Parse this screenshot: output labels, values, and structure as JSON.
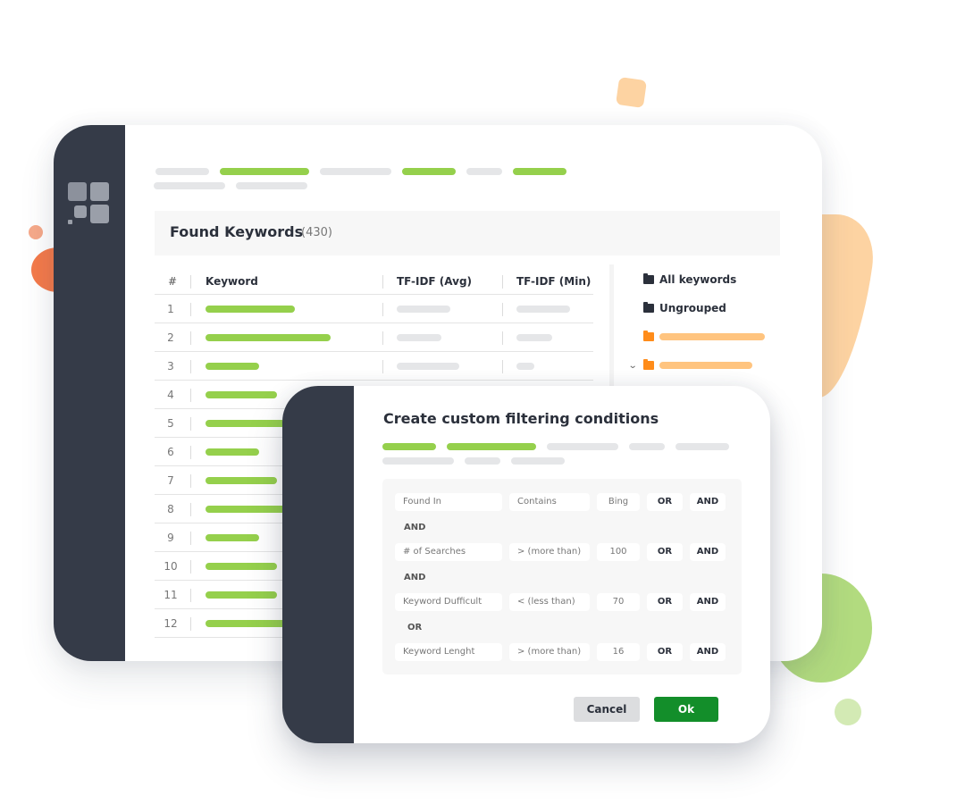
{
  "colors": {
    "sidebar": "#353b48",
    "accent_green": "#95d04c",
    "ok_button": "#138e2a",
    "folder_orange": "#ff8c1a"
  },
  "main_window": {
    "logo": "app-logo-icon",
    "header": {
      "title": "Found Keywords",
      "count": "(430)"
    },
    "table": {
      "columns": [
        "#",
        "Keyword",
        "TF-IDF (Avg)",
        "TF-IDF (Min)"
      ],
      "rows": [
        {
          "num": "1"
        },
        {
          "num": "2"
        },
        {
          "num": "3"
        },
        {
          "num": "4"
        },
        {
          "num": "5"
        },
        {
          "num": "6"
        },
        {
          "num": "7"
        },
        {
          "num": "8"
        },
        {
          "num": "9"
        },
        {
          "num": "10"
        },
        {
          "num": "11"
        },
        {
          "num": "12"
        }
      ]
    },
    "folders": [
      {
        "label": "All keywords",
        "icon": "folder-icon"
      },
      {
        "label": "Ungrouped",
        "icon": "folder-icon"
      }
    ]
  },
  "dialog": {
    "title": "Create custom filtering conditions",
    "conditions": [
      {
        "field": "Found In",
        "operator": "Contains",
        "value": "Bing",
        "or_label": "OR",
        "and_label": "AND",
        "joiner": "AND"
      },
      {
        "field": "# of Searches",
        "operator": "> (more than)",
        "value": "100",
        "or_label": "OR",
        "and_label": "AND",
        "joiner": "AND"
      },
      {
        "field": "Keyword Dufficult",
        "operator": "< (less than)",
        "value": "70",
        "or_label": "OR",
        "and_label": "AND",
        "joiner": "OR"
      },
      {
        "field": "Keyword Lenght",
        "operator": "> (more than)",
        "value": "16",
        "or_label": "OR",
        "and_label": "AND"
      }
    ],
    "cancel_label": "Cancel",
    "ok_label": "Ok"
  }
}
